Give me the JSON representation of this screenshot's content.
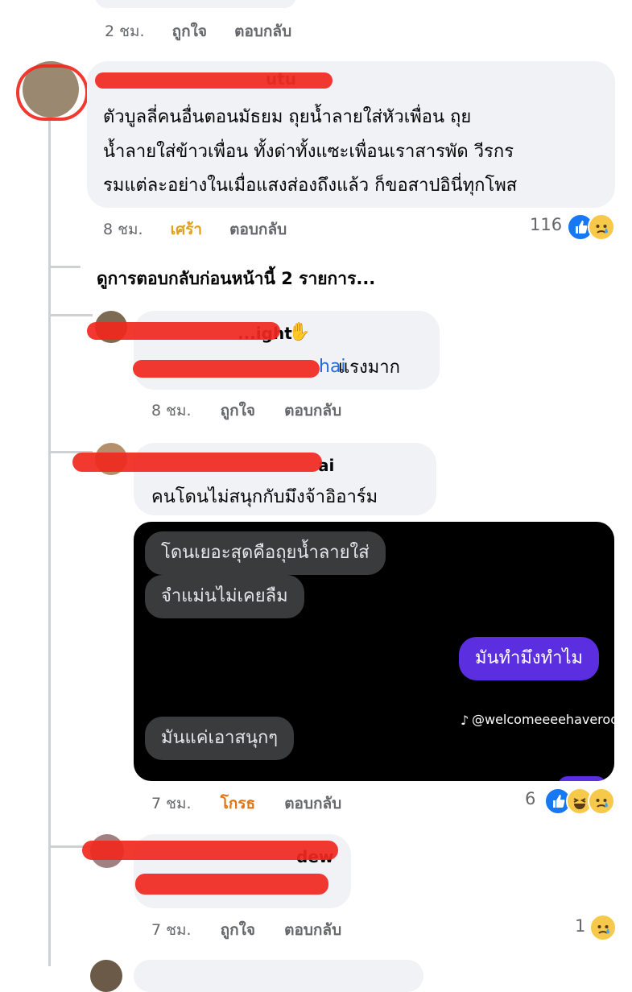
{
  "top_meta": {
    "time": "2 ชม.",
    "like": "ถูกใจ",
    "reply": "ตอบกลับ"
  },
  "comment1": {
    "name_fragment": "utu",
    "lines": [
      "ตัวบูลลี่คนอื่นตอนมัธยม ถุยน้ำลายใส่หัวเพื่อน ถุย",
      "น้ำลายใส่ข้าวเพื่อน ทั้งด่าทั้งแซะเพื่อนเราสารพัด วีรกร",
      "รมแต่ละอย่างในเมื่อแสงส่องถึงแล้ว ก็ขอสาปอินี่ทุกโพส"
    ],
    "time": "8 ชม.",
    "reaction_label": "เศร้า",
    "reply": "ตอบกลับ",
    "reaction_count": "116",
    "reactions": [
      "like-icon",
      "sad-icon"
    ]
  },
  "more_replies": "ดูการตอบกลับก่อนหน้านี้ 2 รายการ...",
  "reply1": {
    "name_fragment": "...ight",
    "badge_icon": "wave-hand-icon",
    "mention_fragment": "hai",
    "text": " แรงมาก",
    "time": "8 ชม.",
    "like": "ถูกใจ",
    "reply": "ตอบกลับ"
  },
  "reply2": {
    "name_fragment": "ai",
    "text": "คนโดนไม่สนุกกับมึงจ้าอิอาร์ม",
    "chat": {
      "msg1": "โดนเยอะสุดคือถุยน้ำลายใส่",
      "msg2": "จำแม่นไม่เคยลืม",
      "msg3": "มันทำมึงทำไม",
      "msg4": "มันแค่เอาสนุกๆ",
      "watermark": "@welcomeeeehaveroom"
    },
    "time": "7 ชม.",
    "reaction_label": "โกรธ",
    "reply": "ตอบกลับ",
    "reaction_count": "6",
    "reactions": [
      "like-icon",
      "haha-icon",
      "sad-icon"
    ]
  },
  "reply3": {
    "name_fragment": "dew",
    "time": "7 ชม.",
    "like": "ถูกใจ",
    "reply": "ตอบกลับ",
    "reaction_count": "1",
    "reactions": [
      "sad-icon"
    ]
  },
  "colors": {
    "bubble": "#f0f2f5",
    "meta": "#65676b",
    "sad_label": "#e0a019",
    "angry_label": "#e07312",
    "like_blue": "#1877f2",
    "chat_out": "#5b2fe0",
    "redaction": "#f0281e"
  }
}
